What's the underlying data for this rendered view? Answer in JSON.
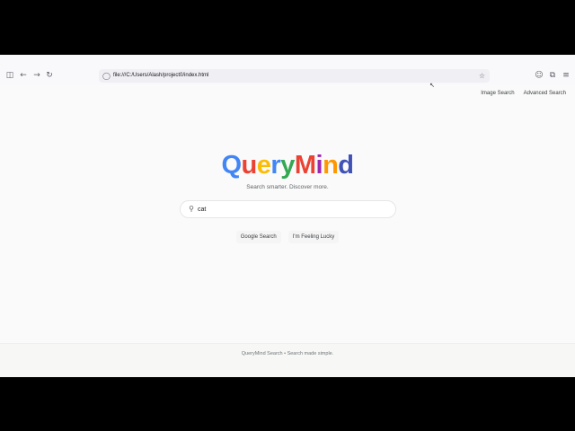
{
  "browser": {
    "url": "file:///C:/Users/Alash/project0/index.html",
    "icons": {
      "sidebar": "sidebar-icon",
      "back": "back-arrow-icon",
      "forward": "forward-arrow-icon",
      "reload": "reload-icon",
      "shield": "shield-icon",
      "star": "bookmark-star-icon",
      "account": "account-icon",
      "extensions": "extensions-icon",
      "menu": "menu-icon"
    }
  },
  "header": {
    "image_search": "Image Search",
    "advanced_search": "Advanced Search"
  },
  "logo": {
    "letters": [
      {
        "char": "Q",
        "color": "#4285f4"
      },
      {
        "char": "u",
        "color": "#ea4335"
      },
      {
        "char": "e",
        "color": "#fbbc05"
      },
      {
        "char": "r",
        "color": "#4285f4"
      },
      {
        "char": "y",
        "color": "#34a853"
      },
      {
        "char": "M",
        "color": "#ea4335"
      },
      {
        "char": "i",
        "color": "#9c27b0"
      },
      {
        "char": "n",
        "color": "#ff9800"
      },
      {
        "char": "d",
        "color": "#3f51b5"
      }
    ],
    "tagline": "Search smarter. Discover more."
  },
  "search": {
    "value": "cat",
    "google_search": "Google Search",
    "feeling_lucky": "I'm Feeling Lucky"
  },
  "footer": {
    "text": "QueryMind Search  •  Search made simple."
  }
}
